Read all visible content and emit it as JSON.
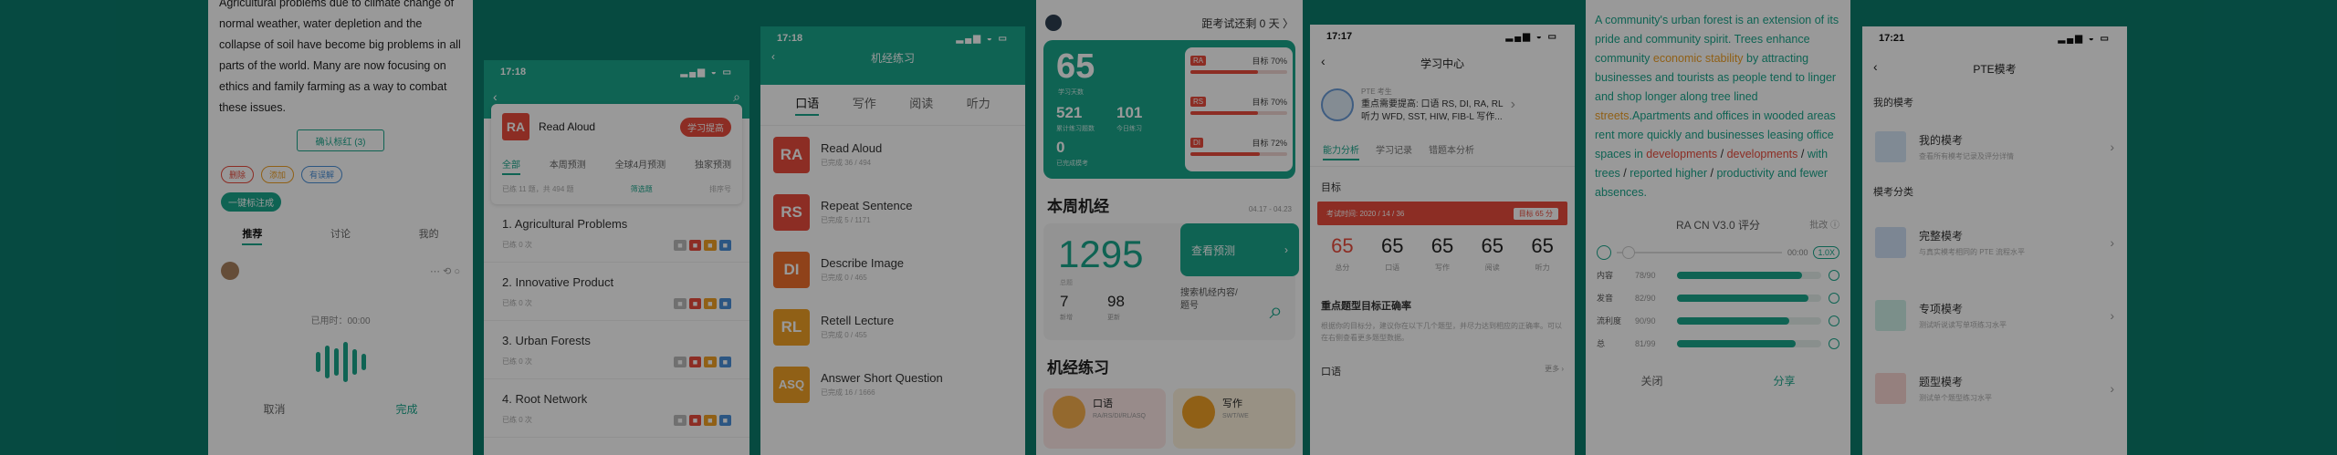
{
  "phone1": {
    "paragraph": "Agricultural problems due to climate change of normal weather, water depletion and the collapse of soil have become big problems in all parts of the world. Many are now focusing on ethics and family farming as a way to combat these issues.",
    "confirm_button": "确认标红 (3)",
    "tags": [
      "删除",
      "添加",
      "有误解"
    ],
    "one_click_button": "一键标注成",
    "tabs": [
      "推荐",
      "讨论",
      "我的"
    ],
    "recording_label": "已用时：00:00",
    "cancel_label": "取消",
    "done_label": "完成"
  },
  "phone2": {
    "time": "17:18",
    "card_code": "RA",
    "card_title": "Read Aloud",
    "practice_button": "学习提高",
    "subtabs": [
      "全部",
      "本周预测",
      "全球4月预测",
      "独家预测"
    ],
    "meta_left": "已练 11 题，共 494 题",
    "meta_mid": "筛选题",
    "meta_right": "排序号",
    "items": [
      {
        "title": "1. Agricultural Problems",
        "sub": "已练 0 次"
      },
      {
        "title": "2. Innovative Product",
        "sub": "已练 0 次"
      },
      {
        "title": "3. Urban Forests",
        "sub": "已练 0 次"
      },
      {
        "title": "4. Root Network",
        "sub": "已练 0 次"
      }
    ]
  },
  "phone3": {
    "time": "17:18",
    "title": "机经练习",
    "tabs": [
      "口语",
      "写作",
      "阅读",
      "听力"
    ],
    "items": [
      {
        "code": "RA",
        "name": "Read Aloud",
        "count": "已完成 36 / 494",
        "color": "#e94b3c"
      },
      {
        "code": "RS",
        "name": "Repeat Sentence",
        "count": "已完成 5 / 1171",
        "color": "#e94b3c"
      },
      {
        "code": "DI",
        "name": "Describe Image",
        "count": "已完成 0 / 465",
        "color": "#ee6e2c"
      },
      {
        "code": "RL",
        "name": "Retell Lecture",
        "count": "已完成 0 / 455",
        "color": "#f0a026"
      },
      {
        "code": "ASQ",
        "name": "Answer Short Question",
        "count": "已完成 16 / 1666",
        "color": "#f0a026"
      }
    ]
  },
  "phone4": {
    "countdown": "距考试还剩 0 天 〉",
    "total_days": "65",
    "total_days_label": "学习天数",
    "s1": "521",
    "s1_label": "累计练习题数",
    "s2": "101",
    "s2_label": "今日练习",
    "s3": "0",
    "s3_label": "已完成模考",
    "goals": [
      {
        "tag": "RA",
        "label": "目标",
        "pct": "70%",
        "fill": 0.7
      },
      {
        "tag": "RS",
        "label": "目标",
        "pct": "70%",
        "fill": 0.7
      },
      {
        "tag": "DI",
        "label": "目标",
        "pct": "72%",
        "fill": 0.72
      }
    ],
    "week_title": "本周机经",
    "week_range": "04.17 - 04.23",
    "week_count": "1295",
    "week_count_label": "总题",
    "a": "7",
    "a_label": "新增",
    "b": "98",
    "b_label": "更新",
    "view_button": "查看预测",
    "search_text": "搜索机经内容/题号",
    "practice_title": "机经练习",
    "oral_card": "口语",
    "oral_sub": "RA/RS/DI/RL/ASQ",
    "write_card": "写作",
    "write_sub": "SWT/WE"
  },
  "phone5": {
    "time": "17:17",
    "title": "学习中心",
    "profile_line1": "PTE 考生",
    "profile_line2": "重点需要提高: 口语 RS, DI, RA, RL",
    "profile_line3": "听力 WFD, SST, HIW, FIB-L 写作...",
    "tabs": [
      "能力分析",
      "学习记录",
      "错题本分析"
    ],
    "goal_title": "目标",
    "goal_bar_left": "考试时间: 2020 / 14 / 36",
    "goal_bar_right": "目标 65 分",
    "scores": [
      {
        "v": "65",
        "l": "总分",
        "red": true
      },
      {
        "v": "65",
        "l": "口语",
        "red": false
      },
      {
        "v": "65",
        "l": "写作",
        "red": false
      },
      {
        "v": "65",
        "l": "阅读",
        "red": false
      },
      {
        "v": "65",
        "l": "听力",
        "red": false
      }
    ],
    "sub_title": "重点题型目标正确率",
    "sub_text": "根据你的目标分，建议你在以下几个题型，并尽力达到相应的正确率。可以在右侧查看更多题型数据。",
    "oral_label": "口语",
    "oral_right": "更多 ›"
  },
  "phone6": {
    "title": "RA CN V3.0 评分",
    "title_right": "批改 ⓘ",
    "time_label": "00:00",
    "speed": "1.0X",
    "rows": [
      {
        "label": "内容",
        "val": "78/90",
        "fill": 0.87
      },
      {
        "label": "发音",
        "val": "82/90",
        "fill": 0.91
      },
      {
        "label": "流利度",
        "val": "90/90",
        "fill": 0.78
      },
      {
        "label": "总",
        "val": "81/99",
        "fill": 0.82
      }
    ],
    "cancel_label": "关闭",
    "share_label": "分享"
  },
  "phone7": {
    "time": "17:21",
    "title": "PTE模考",
    "group1": "我的模考",
    "group2": "模考分类",
    "items": [
      {
        "name": "我的模考",
        "desc": "查看所有模考记录及评分详情",
        "color": "#4a90d9"
      },
      {
        "name": "完整模考",
        "desc": "与真实模考相同的 PTE 流程水平",
        "color": "#4a90d9"
      },
      {
        "name": "专项模考",
        "desc": "测试听说读写单项练习水平",
        "color": "#19a58b"
      },
      {
        "name": "题型模考",
        "desc": "测试单个题型练习水平",
        "color": "#e94b3c"
      }
    ]
  }
}
